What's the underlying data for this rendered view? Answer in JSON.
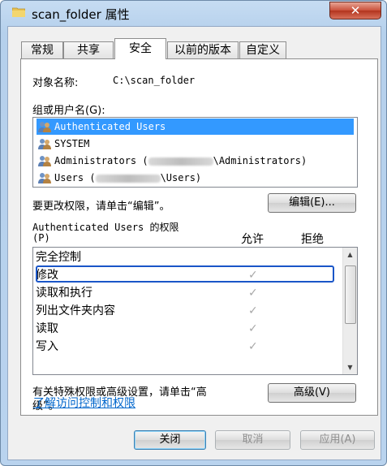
{
  "window": {
    "title": "scan_folder 属性",
    "close_label": "✕"
  },
  "tabs": [
    {
      "label": "常规",
      "active": false
    },
    {
      "label": "共享",
      "active": false
    },
    {
      "label": "安全",
      "active": true
    },
    {
      "label": "以前的版本",
      "active": false
    },
    {
      "label": "自定义",
      "active": false
    }
  ],
  "security": {
    "object_name_label": "对象名称:",
    "object_name_value": "C:\\scan_folder",
    "group_label": "组或用户名(G):",
    "users": [
      {
        "name": "Authenticated Users",
        "selected": true
      },
      {
        "name": "SYSTEM",
        "selected": false
      },
      {
        "prefix": "Administrators (",
        "suffix": "\\Administrators)",
        "selected": false
      },
      {
        "prefix": "Users (",
        "suffix": "\\Users)",
        "selected": false
      }
    ],
    "change_hint": "要更改权限，请单击“编辑”。",
    "edit_button": "编辑(E)...",
    "perm_title_line1": "Authenticated Users 的权限",
    "perm_title_line2": "(P)",
    "allow_header": "允许",
    "deny_header": "拒绝",
    "permissions": [
      {
        "name": "完全控制",
        "allow": false
      },
      {
        "name": "修改",
        "allow": true
      },
      {
        "name": "读取和执行",
        "allow": true
      },
      {
        "name": "列出文件夹内容",
        "allow": true
      },
      {
        "name": "读取",
        "allow": true
      },
      {
        "name": "写入",
        "allow": true
      }
    ],
    "check_glyph": "✓",
    "advanced_hint_line1": "有关特殊权限或高级设置，请单击“高",
    "advanced_hint_line2": "级”。",
    "advanced_button": "高级(V)",
    "learn_link": "了解访问控制和权限"
  },
  "footer": {
    "close_button": "关闭",
    "cancel_button": "取消",
    "apply_button": "应用(A)"
  },
  "colors": {
    "selection": "#3399ff",
    "highlight_box": "#1a56c8",
    "link": "#0066cc"
  }
}
